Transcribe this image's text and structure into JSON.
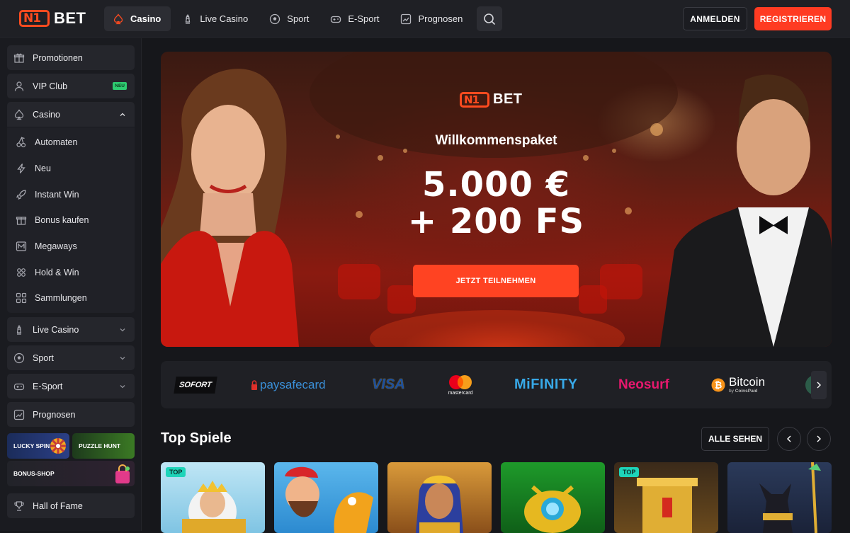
{
  "brand": {
    "logo_text": "BET",
    "logo_mark": "N1"
  },
  "nav": {
    "items": [
      {
        "label": "Casino",
        "icon": "spade-icon",
        "active": true
      },
      {
        "label": "Live Casino",
        "icon": "chess-icon",
        "active": false
      },
      {
        "label": "Sport",
        "icon": "soccer-ball-icon",
        "active": false
      },
      {
        "label": "E-Sport",
        "icon": "gamepad-icon",
        "active": false
      },
      {
        "label": "Prognosen",
        "icon": "chart-icon",
        "active": false
      }
    ],
    "search_icon": "search-icon",
    "login_label": "ANMELDEN",
    "register_label": "REGISTRIEREN"
  },
  "sidebar": {
    "items": [
      {
        "label": "Promotionen",
        "icon": "gift-icon"
      },
      {
        "label": "VIP Club",
        "icon": "vip-icon",
        "badge": "NEU"
      },
      {
        "label": "Casino",
        "icon": "spade-icon",
        "expanded": true
      },
      {
        "label": "Live Casino",
        "icon": "chess-icon"
      },
      {
        "label": "Sport",
        "icon": "soccer-ball-icon"
      },
      {
        "label": "E-Sport",
        "icon": "gamepad-icon"
      },
      {
        "label": "Prognosen",
        "icon": "chart-icon"
      },
      {
        "label": "Hall of Fame",
        "icon": "trophy-icon"
      }
    ],
    "casino_sub": [
      {
        "label": "Automaten",
        "icon": "cherries-icon"
      },
      {
        "label": "Neu",
        "icon": "lightning-icon"
      },
      {
        "label": "Instant Win",
        "icon": "rocket-icon"
      },
      {
        "label": "Bonus kaufen",
        "icon": "gift-box-icon"
      },
      {
        "label": "Megaways",
        "icon": "megaways-icon"
      },
      {
        "label": "Hold & Win",
        "icon": "coins-icon"
      },
      {
        "label": "Sammlungen",
        "icon": "grid-icon"
      }
    ],
    "promo_tiles": [
      "LUCKY SPIN",
      "PUZZLE HUNT",
      "BONUS-SHOP"
    ]
  },
  "hero": {
    "logo_text": "BET",
    "subtitle": "Willkommenspaket",
    "amount_line1": "5.000 €",
    "amount_line2": "+ 200 FS",
    "cta": "JETZT TEILNEHMEN"
  },
  "payments": {
    "sofort": "SOFORT",
    "paysafecard": "paysafecard",
    "visa": "VISA",
    "mastercard": "mastercard",
    "mifinity": "MiFINITY",
    "neosurf": "Neosurf",
    "bitcoin": "Bitcoin",
    "bitcoin_by": "by",
    "coinspaid": "CoinsPaid"
  },
  "top_games": {
    "title": "Top Spiele",
    "see_all": "ALLE SEHEN",
    "tag": "TOP"
  },
  "colors": {
    "accent": "#ff3b22",
    "teal_tag": "#1ed4b9",
    "neu_badge": "#2ecc71"
  }
}
